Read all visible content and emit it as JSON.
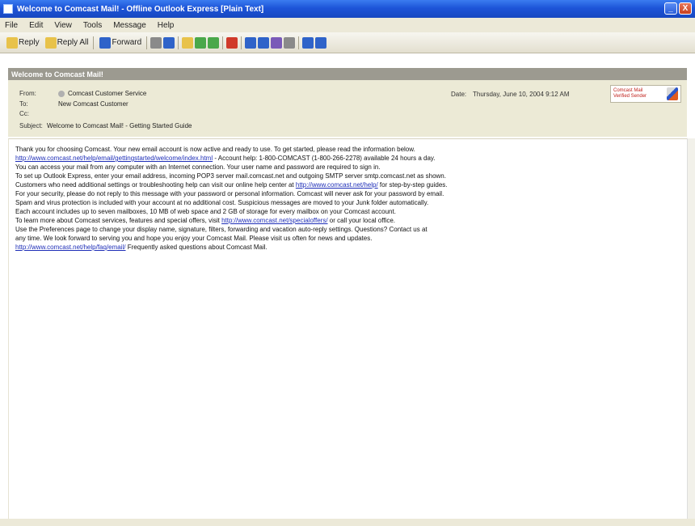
{
  "window": {
    "title": "Welcome to Comcast Mail! - Offline Outlook Express [Plain Text]",
    "minimize_glyph": "_",
    "close_glyph": "X"
  },
  "menu": [
    "File",
    "Edit",
    "View",
    "Tools",
    "Message",
    "Help"
  ],
  "toolbar": {
    "reply": "Reply",
    "reply_all": "Reply All",
    "forward": "Forward"
  },
  "subject_banner": "Welcome to Comcast Mail!",
  "header": {
    "from_label": "From:",
    "from_value": "Comcast Customer Service",
    "date_label": "Date:",
    "date_value": "Thursday, June 10, 2004 9:12 AM",
    "to_label": "To:",
    "to_value": "New Comcast Customer",
    "cc_label": "Cc:",
    "subject_label": "Subject:",
    "subject_value": "Welcome to Comcast Mail! - Getting Started Guide",
    "stamp_line1": "Comcast Mail",
    "stamp_line2": "Verified Sender"
  },
  "body": {
    "line1": "Thank you for choosing Comcast. Your new email account is now active and ready to use. To get started, please read the information below.",
    "line2_link": "http://www.comcast.net/help/email/gettingstarted/welcome/index.html",
    "line2_rest": " - Account help: 1-800-COMCAST (1-800-266-2278) available 24 hours a day.",
    "line3": "You can access your mail from any computer with an Internet connection. Your user name and password are required to sign in.",
    "line4": "To set up Outlook Express, enter your email address, incoming POP3 server mail.comcast.net and outgoing SMTP server smtp.comcast.net as shown.",
    "line5a": "Customers who need additional settings or troubleshooting help can visit our online help center at ",
    "line5_link": "http://www.comcast.net/help/",
    "line5b": " for step-by-step guides.",
    "line6": "For your security, please do not reply to this message with your password or personal information. Comcast will never ask for your password by email.",
    "line7": "Spam and virus protection is included with your account at no additional cost. Suspicious messages are moved to your Junk folder automatically.",
    "line8": "Each account includes up to seven mailboxes, 10 MB of web space and 2 GB of storage for every mailbox on your Comcast account.",
    "line9a": "To learn more about Comcast services, features and special offers, visit ",
    "line9_link": "http://www.comcast.net/specialoffers/",
    "line9b": " or call your local office.",
    "line10": "Use the Preferences page to change your display name, signature, filters, forwarding and vacation auto-reply settings. Questions? Contact us at",
    "line11": "any time. We look forward to serving you and hope you enjoy your Comcast Mail. Please visit us often for news and updates.",
    "line12_link": "http://www.comcast.net/help/faq/email/",
    "line12_rest": " Frequently asked questions about Comcast Mail."
  },
  "colors": {
    "titlebar": "#1d54d8",
    "panel": "#ecead6",
    "banner": "#9c9a90",
    "link": "#1f2fb8"
  }
}
